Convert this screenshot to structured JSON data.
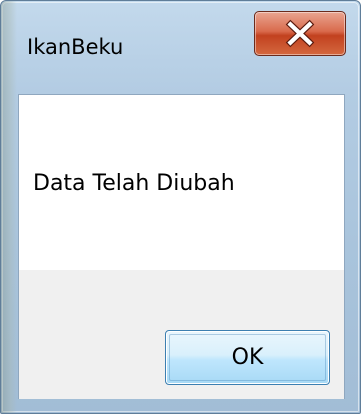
{
  "window": {
    "title": "IkanBeku"
  },
  "dialog": {
    "message": "Data Telah Diubah",
    "ok_label": "OK"
  },
  "icons": {
    "close": "close-icon"
  },
  "colors": {
    "close_button": "#c94a2a",
    "ok_button_border": "#3c7fb1",
    "frame": "#b3cce3",
    "button_area": "#f0f0f0"
  }
}
